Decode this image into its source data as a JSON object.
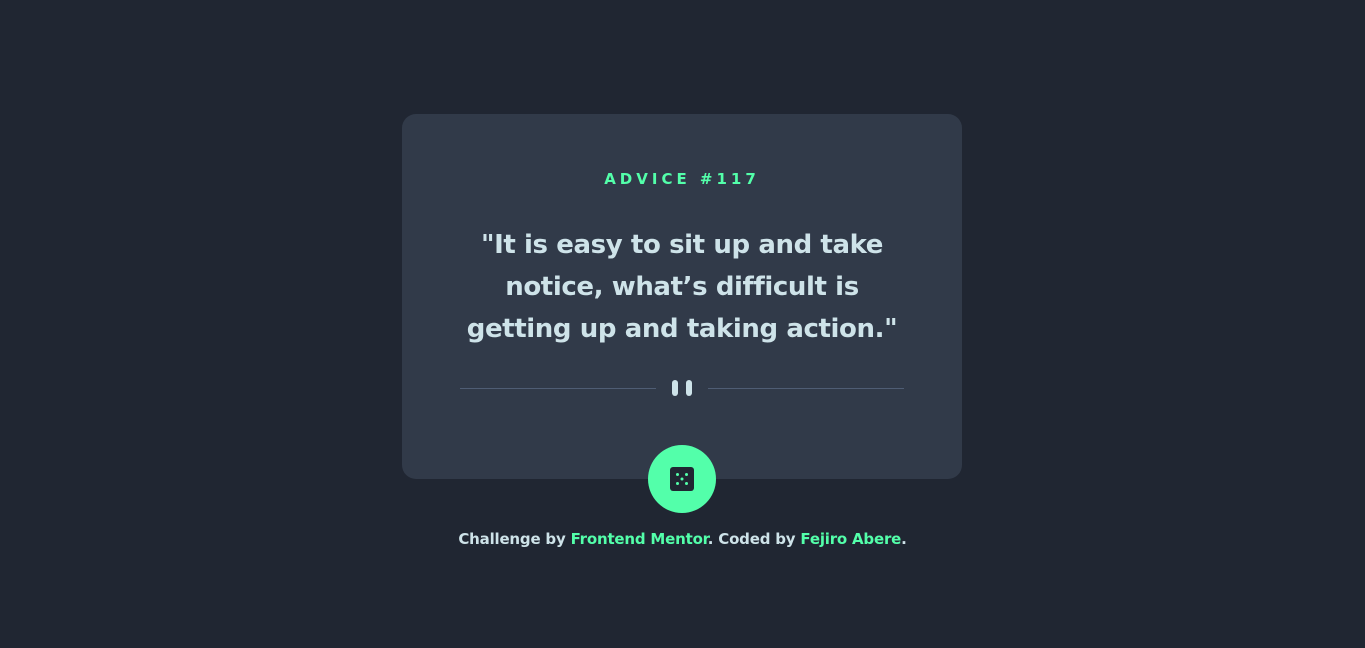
{
  "advice": {
    "label": "ADVICE #117",
    "quote": "\"It is easy to sit up and take notice, what’s difficult is getting up and taking action.\""
  },
  "divider": {
    "icon": "pause-icon"
  },
  "dice_button": {
    "icon": "dice-icon"
  },
  "attribution": {
    "prefix": "Challenge by ",
    "challenge_link": "Frontend Mentor",
    "middle": ". Coded by ",
    "author_link": "Fejiro Abere",
    "suffix": "."
  },
  "colors": {
    "background": "#202632",
    "card": "#313A49",
    "accent": "#53FFAA",
    "text": "#CEE3E9",
    "divider": "#4F5D74"
  }
}
